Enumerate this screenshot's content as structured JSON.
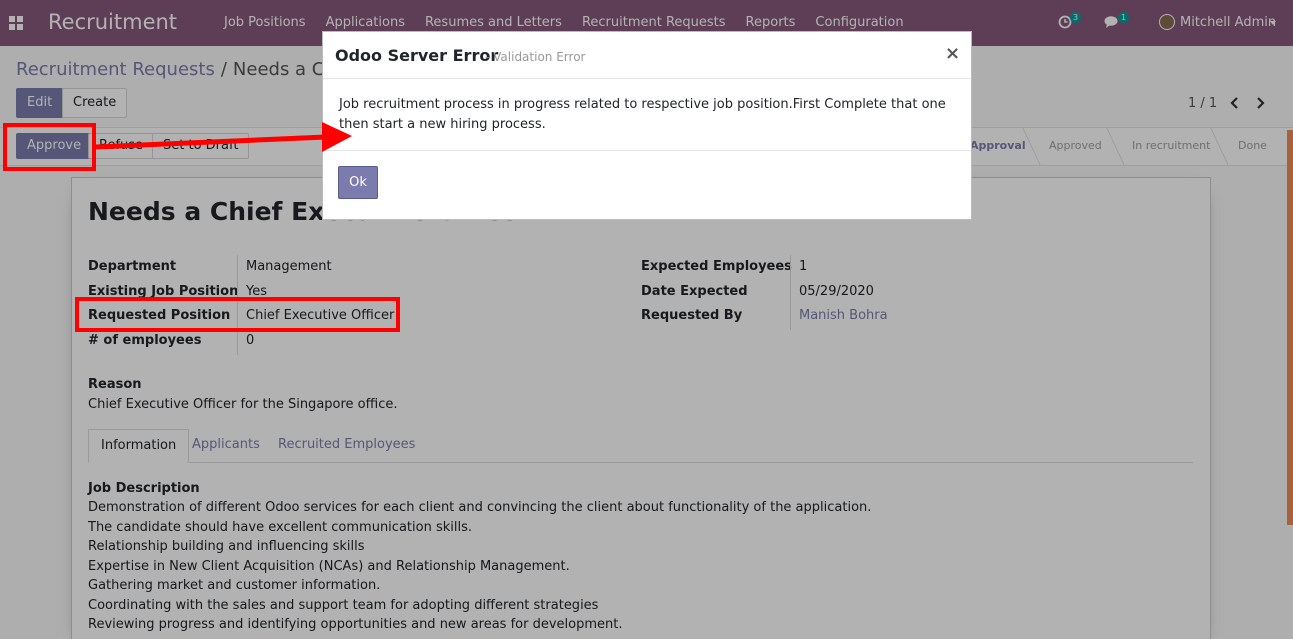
{
  "navbar": {
    "app_title": "Recruitment",
    "menu": [
      "Job Positions",
      "Applications",
      "Resumes and Letters",
      "Recruitment Requests",
      "Reports",
      "Configuration"
    ],
    "activity_count": "3",
    "message_count": "1",
    "user_name": "Mitchell Admin"
  },
  "breadcrumb": {
    "parent": "Recruitment Requests",
    "separator": "/",
    "current": "Needs a Chief Executive Officer"
  },
  "buttons": {
    "edit": "Edit",
    "create": "Create",
    "approve": "Approve",
    "refuse": "Refuse",
    "set_to_draft": "Set to Draft"
  },
  "pager": {
    "value": "1 / 1"
  },
  "statusbar": [
    "Approval",
    "Approved",
    "In recruitment",
    "Done"
  ],
  "statusbar_active": "Approval",
  "form": {
    "title": "Needs a Chief Executive Officer",
    "left_fields": [
      {
        "label": "Department",
        "value": "Management"
      },
      {
        "label": "Existing Job Position",
        "value": "Yes"
      },
      {
        "label": "Requested Position",
        "value": "Chief Executive Officer"
      },
      {
        "label": "# of employees",
        "value": "0"
      }
    ],
    "right_fields": [
      {
        "label": "Expected Employees",
        "value": "1"
      },
      {
        "label": "Date Expected",
        "value": "05/29/2020"
      },
      {
        "label": "Requested By",
        "value": "Manish Bohra"
      }
    ],
    "reason_label": "Reason",
    "reason_text": "Chief Executive Officer for the Singapore office.",
    "tabs": [
      "Information",
      "Applicants",
      "Recruited Employees"
    ],
    "job_description_label": "Job Description",
    "job_description": [
      "Demonstration of different Odoo services for each client and convincing the client about functionality of the application.",
      "The candidate should have excellent communication skills.",
      "Relationship building and influencing skills",
      "Expertise in New Client Acquisition (NCAs) and Relationship Management.",
      "Gathering market and customer information.",
      "Coordinating with the sales and support team for adopting different strategies",
      "Reviewing progress and identifying opportunities and new areas for development."
    ]
  },
  "dialog": {
    "title": "Odoo Server Error",
    "subtitle": "- Validation Error",
    "close_glyph": "×",
    "message": "Job recruitment process in progress related to respective job position.First Complete that one then start a new hiring process.",
    "ok_label": "Ok"
  },
  "colors": {
    "navbar": "#875a7b",
    "primary": "#7c7bad",
    "annotation": "#ff0000"
  }
}
